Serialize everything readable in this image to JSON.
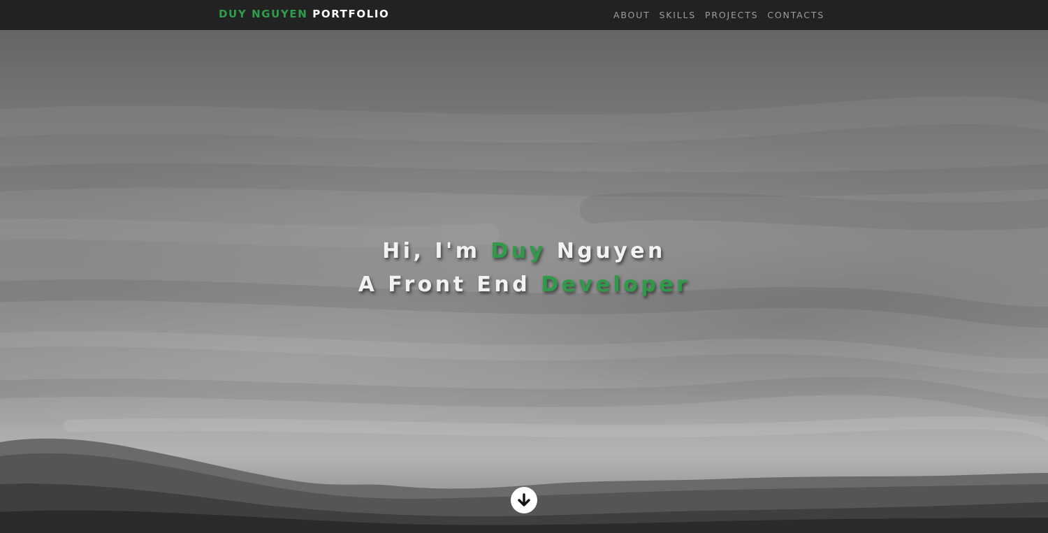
{
  "navbar": {
    "brand_first": "DUY NGUYEN",
    "brand_second": "PORTFOLIO",
    "links": [
      "ABOUT",
      "SKILLS",
      "PROJECTS",
      "CONTACTS"
    ]
  },
  "hero": {
    "line1_pre": "Hi, I'm",
    "line1_accent": "Duy",
    "line1_post": "Nguyen",
    "line2_pre": "A Front End",
    "line2_accent": "Developer"
  },
  "icons": {
    "scroll_down": "arrow-down-circle-icon"
  },
  "colors": {
    "accent": "#2e9e4a",
    "navbar_bg": "#222222",
    "nav_link": "#9d9d9d",
    "hero_text": "#f2f2f2"
  }
}
